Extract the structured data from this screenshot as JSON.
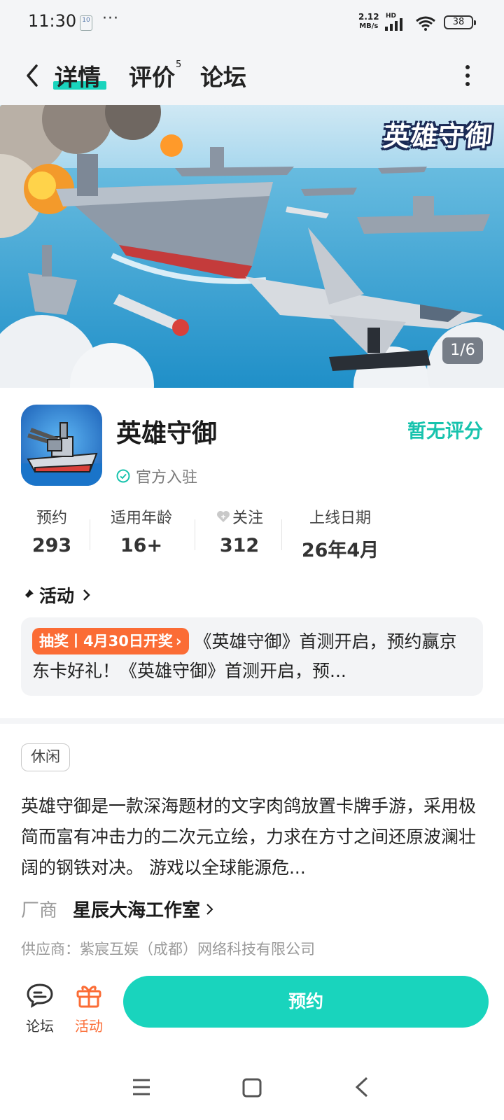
{
  "status_bar": {
    "time": "11:30",
    "notif_badge": "10",
    "dots": "···",
    "speed_value": "2.12",
    "speed_unit": "MB/s",
    "hd": "HD",
    "battery": "38"
  },
  "header": {
    "tabs": [
      {
        "label": "详情",
        "active": true
      },
      {
        "label": "评价",
        "badge": "5"
      },
      {
        "label": "论坛"
      }
    ]
  },
  "hero": {
    "logo_text": "英雄守御",
    "counter": "1/6"
  },
  "app": {
    "name": "英雄守御",
    "official": "官方入驻",
    "rating": "暂无评分"
  },
  "stats": [
    {
      "label": "预约",
      "value": "293"
    },
    {
      "label": "适用年龄",
      "value": "16+"
    },
    {
      "label": "关注",
      "value": "312"
    },
    {
      "label": "上线日期",
      "value": "26年4月"
    }
  ],
  "activity": {
    "heading": "活动",
    "tag": "抽奖丨4月30日开奖",
    "tag_arrow": "›",
    "text": "《英雄守御》首测开启，预约赢京东卡好礼！《英雄守御》首测开启，预..."
  },
  "description": {
    "genre": "休闲",
    "text": "英雄守御是一款深海题材的文字肉鸽放置卡牌手游，采用极简而富有冲击力的二次元立绘，力求在方寸之间还原波澜壮阔的钢铁对决。 游戏以全球能源危..."
  },
  "developer": {
    "label": "厂商",
    "name": "星辰大海工作室",
    "supplier": "供应商：紫宸互娱（成都）网络科技有限公司"
  },
  "bottom_bar": {
    "forum": "论坛",
    "activity": "活动",
    "reserve": "预约"
  },
  "colors": {
    "accent": "#19d4bd",
    "orange": "#fb6c35"
  }
}
